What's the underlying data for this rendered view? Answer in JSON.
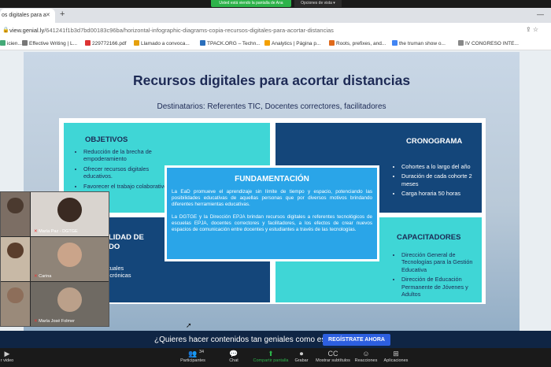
{
  "zoom_share": {
    "notice": "Usted está viendo la pantalla de Ana",
    "view_options": "Opciones de vista"
  },
  "browser": {
    "tab_title": "os digitales para a",
    "url_host": "view.genial.ly",
    "url_path": "/641241f1b3d7bd00183c96ba/horizontal-infographic-diagrams-copia-recursos-digitales-para-acortar-distancias",
    "bookmarks": [
      {
        "label": "icien...",
        "color": "#4a7"
      },
      {
        "label": "Effective Writing | L...",
        "color": "#777"
      },
      {
        "label": "229772166.pdf",
        "color": "#d33"
      },
      {
        "label": "Llamado a convoca...",
        "color": "#e5a00d"
      },
      {
        "label": "TPACK.ORG – Techn...",
        "color": "#2a6ebb"
      },
      {
        "label": "Analytics | Página p...",
        "color": "#f4a000"
      },
      {
        "label": "Roots, prefixes, and...",
        "color": "#e06a1b"
      },
      {
        "label": "the truman show o...",
        "color": "#4285f4"
      },
      {
        "label": "IV CONGRESO INTE...",
        "color": "#888"
      }
    ]
  },
  "slide": {
    "title": "Recursos digitales para acortar distancias",
    "subtitle": "Destinatarios: Referentes TIC, Docentes correctores, facilitadores",
    "objetivos": {
      "title": "OBJETIVOS",
      "items": [
        "Reducción de la brecha de empoderamiento",
        "Ofrecer recursos digitales educativos.",
        "Favorecer el trabajo colaborativo."
      ]
    },
    "cronograma": {
      "title": "CRONOGRAMA",
      "items": [
        "Cohortes a lo largo del año",
        "Duración de cada cohorte 2 meses",
        "Carga horaria 50 horas"
      ]
    },
    "fundamentacion": {
      "title": "FUNDAMENTACIÓN",
      "p1": "La EaD promueve el aprendizaje sin límite de tiempo y espacio, potenciando las posibilidades educativas de aquellas personas que por diversos motivos brindando diferentes herramientas educativas.",
      "p2": "La DGTGE y la Dirección EPJA brindan recursos digitales a referentes tecnológicos de escuelas EPJA, docentes correctores y facilitadores, a los efectos de crear nuevos espacios de comunicación entre docentes y estudiantes a través de las tecnologías."
    },
    "capacitadores": {
      "title": "CAPACITADORES",
      "items": [
        "Dirección General de Tecnologías para la Gestión Educativa",
        "Dirección de Educación Permanente de Jóvenes y Adultos"
      ]
    },
    "modalidad": {
      "title": "LIDAD DE\nDO",
      "items": [
        "virtuales",
        "sincrónicas",
        "de",
        "les"
      ]
    }
  },
  "banner": {
    "text": "¿Quieres hacer contenidos tan geniales como este?",
    "cta": "REGÍSTRATE AHORA"
  },
  "video_panel": {
    "participants": [
      {
        "name": ""
      },
      {
        "name": "María Paz - DGTGE"
      },
      {
        "name": ""
      },
      {
        "name": "Carina"
      },
      {
        "name": ""
      },
      {
        "name": "María José Folmer"
      }
    ]
  },
  "zoom_toolbar": {
    "items": [
      {
        "label": "r video",
        "icon": "▶"
      },
      {
        "label": "Participantes",
        "icon": "👥",
        "count": "34"
      },
      {
        "label": "Chat",
        "icon": "💬"
      },
      {
        "label": "Compartir pantalla",
        "icon": "⬆"
      },
      {
        "label": "Grabar",
        "icon": "⏺"
      },
      {
        "label": "Mostrar subtítulos",
        "icon": "CC"
      },
      {
        "label": "Reacciones",
        "icon": "☺"
      },
      {
        "label": "Aplicaciones",
        "icon": "⊞"
      }
    ]
  }
}
